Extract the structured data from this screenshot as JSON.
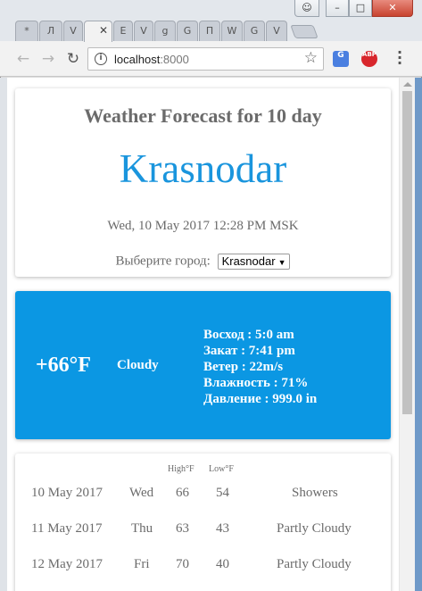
{
  "browser": {
    "tabs": [
      {
        "label": "*"
      },
      {
        "label": "Л"
      },
      {
        "label": "V"
      },
      {
        "label": "",
        "active": true
      },
      {
        "label": "E"
      },
      {
        "label": "V"
      },
      {
        "label": "g"
      },
      {
        "label": "G"
      },
      {
        "label": "П"
      },
      {
        "label": "W"
      },
      {
        "label": "G"
      },
      {
        "label": "V"
      }
    ],
    "url_host": "localhost",
    "url_port": ":8000",
    "translate_badge": "G",
    "abp_badge": "ABP",
    "icons": [
      "back-arrow-icon",
      "forward-arrow-icon",
      "reload-icon",
      "info-icon",
      "star-icon",
      "menu-icon",
      "close-tab-icon"
    ]
  },
  "header": {
    "title": "Weather Forecast for 10 day",
    "city": "Krasnodar",
    "datetime": "Wed, 10 May 2017 12:28 PM MSK",
    "select_label": "Выберите город:",
    "select_value": "Krasnodar"
  },
  "current": {
    "temperature": "+66°F",
    "condition": "Cloudy",
    "details": [
      "Восход : 5:0 am",
      "Закат : 7:41 pm",
      "Ветер : 22m/s",
      "Влажность : 71%",
      "Давление : 999.0 in"
    ]
  },
  "forecast": {
    "col_high": "High°F",
    "col_low": "Low°F",
    "rows": [
      {
        "date": "10 May 2017",
        "day": "Wed",
        "high": "66",
        "low": "54",
        "text": "Showers"
      },
      {
        "date": "11 May 2017",
        "day": "Thu",
        "high": "63",
        "low": "43",
        "text": "Partly Cloudy"
      },
      {
        "date": "12 May 2017",
        "day": "Fri",
        "high": "70",
        "low": "40",
        "text": "Partly Cloudy"
      }
    ]
  },
  "colors": {
    "accent_blue": "#0b97e3",
    "city_blue": "#1a95dd",
    "text_gray": "#6b6b6b"
  }
}
